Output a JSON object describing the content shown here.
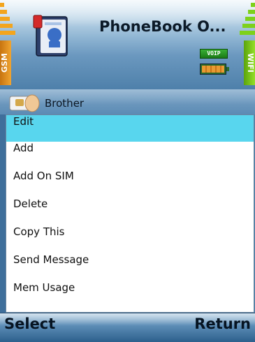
{
  "header": {
    "title": "PhoneBook O...",
    "network_left": "GSM",
    "network_right": "WIFI",
    "voip_badge": "VOIP",
    "app_icon": "phonebook-icon",
    "battery_icon": "battery-icon"
  },
  "contact": {
    "name": "Brother",
    "icon": "sim-card-icon"
  },
  "menu": {
    "selected_index": 0,
    "items": [
      {
        "label": "Edit"
      },
      {
        "label": "Add"
      },
      {
        "label": "Add On SIM"
      },
      {
        "label": "Delete"
      },
      {
        "label": "Copy This"
      },
      {
        "label": "Send Message"
      },
      {
        "label": "Mem Usage"
      }
    ]
  },
  "softkeys": {
    "left": "Select",
    "right": "Return"
  },
  "colors": {
    "selection": "#58d6ee",
    "gsm": "#f3a51d",
    "wifi": "#7ed11c",
    "header_blue": "#4e80aa"
  }
}
